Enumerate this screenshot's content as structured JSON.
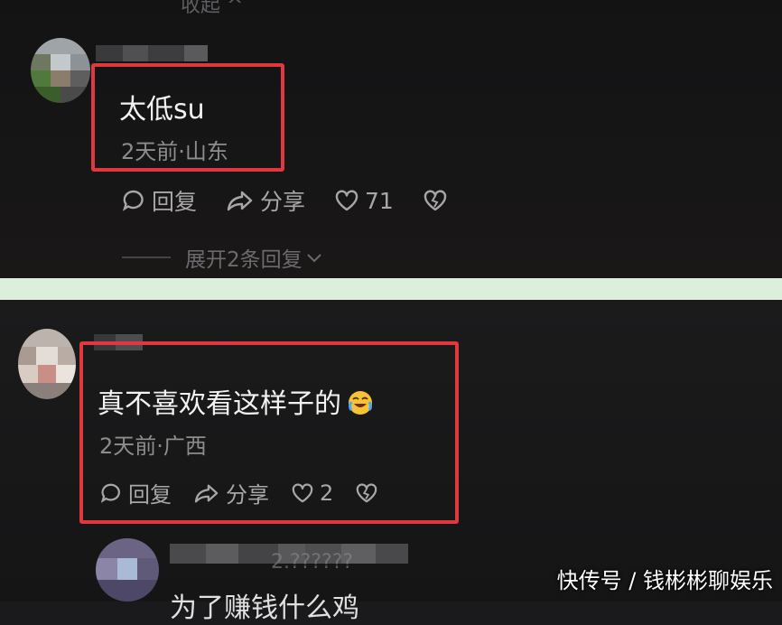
{
  "top_comment": {
    "collapse_label": "收起",
    "text": "太低su",
    "meta": "2天前·山东",
    "reply_label": "回复",
    "share_label": "分享",
    "like_count": "71",
    "expand_replies": "展开2条回复"
  },
  "bottom_comment": {
    "text": "真不喜欢看这样子的",
    "emoji": "laughing-crying-emoji",
    "meta": "2天前·广西",
    "reply_label": "回复",
    "share_label": "分享",
    "like_count": "2"
  },
  "next_comment": {
    "name_fragment": "2.??????",
    "text": "为了赚钱什么鸡"
  },
  "watermark": "快传号 / 钱彬彬聊娱乐",
  "colors": {
    "highlight_box": "#e0383c",
    "divider": "#dbefdc",
    "background": "#161617"
  }
}
